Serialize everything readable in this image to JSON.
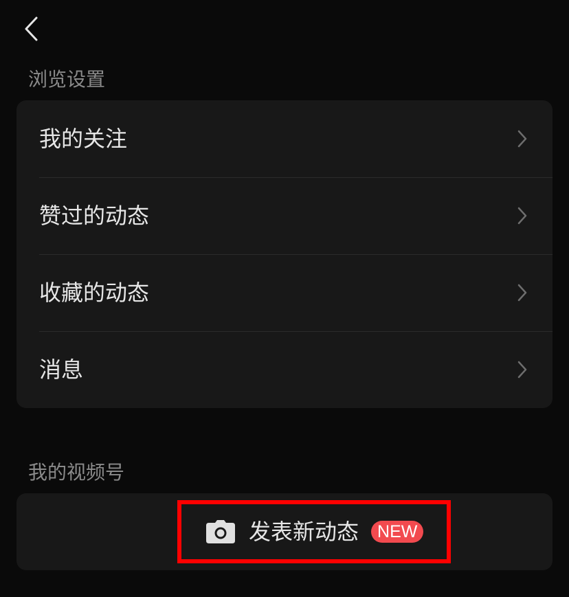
{
  "nav": {
    "back_icon": "chevron-left-icon"
  },
  "browse_section": {
    "title": "浏览设置",
    "items": [
      {
        "label": "我的关注",
        "icon": "chevron-right-icon"
      },
      {
        "label": "赞过的动态",
        "icon": "chevron-right-icon"
      },
      {
        "label": "收藏的动态",
        "icon": "chevron-right-icon"
      },
      {
        "label": "消息",
        "icon": "chevron-right-icon"
      }
    ]
  },
  "channel_section": {
    "title": "我的视频号",
    "post_button": {
      "icon": "camera-icon",
      "label": "发表新动态",
      "badge": "NEW"
    }
  },
  "colors": {
    "background": "#0a0a0a",
    "card": "#181818",
    "text_primary": "#e6e6e6",
    "text_secondary": "#8a8a8a",
    "badge": "#f24a4f",
    "highlight_border": "#ff0000"
  }
}
